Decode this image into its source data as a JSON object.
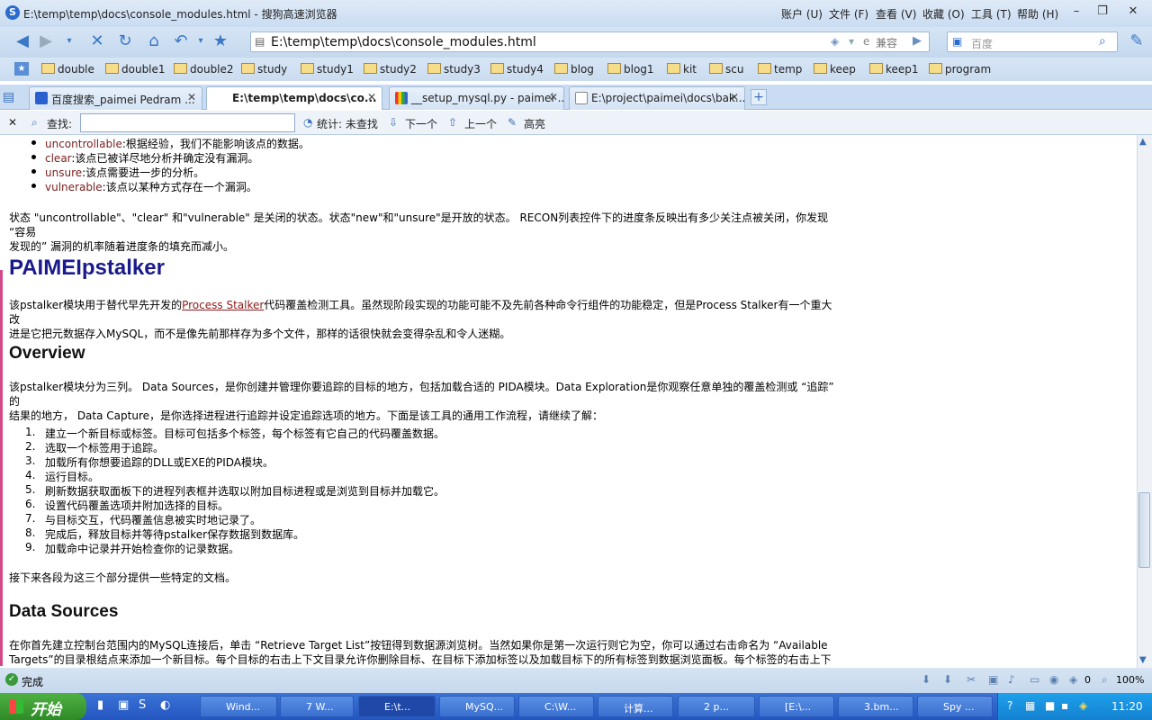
{
  "window": {
    "title": "E:\\temp\\temp\\docs\\console_modules.html - 搜狗高速浏览器",
    "menus": [
      "账户 (U)",
      "文件 (F)",
      "查看 (V)",
      "收藏 (O)",
      "工具 (T)",
      "帮助 (H)"
    ]
  },
  "address": {
    "url": "E:\\temp\\temp\\docs\\console_modules.html",
    "compat": "兼容",
    "search_placeholder": "百度"
  },
  "bookmarks": [
    "double",
    "double1",
    "double2",
    "study",
    "study1",
    "study2",
    "study3",
    "study4",
    "blog",
    "blog1",
    "kit",
    "scu",
    "temp",
    "keep",
    "keep1",
    "program"
  ],
  "tabs": [
    {
      "label": "百度搜索_paimei Pedram ..."
    },
    {
      "label": "E:\\temp\\temp\\docs\\co..."
    },
    {
      "label": "__setup_mysql.py - paimei ..."
    },
    {
      "label": "E:\\project\\paimei\\docs\\bak..."
    }
  ],
  "findbar": {
    "find_label": "查找:",
    "stats": "统计: 未查找",
    "next": "下一个",
    "prev": "上一个",
    "highlight": "高亮"
  },
  "content": {
    "bullets": [
      {
        "k": "uncontrollable",
        "t": ":根据经验，我们不能影响该点的数据。"
      },
      {
        "k": "clear",
        "t": ":该点已被详尽地分析并确定没有漏洞。"
      },
      {
        "k": "unsure",
        "t": ":该点需要进一步的分析。"
      },
      {
        "k": "vulnerable",
        "t": ":该点以某种方式存在一个漏洞。"
      }
    ],
    "state_p1": "状态 \"uncontrollable\"、\"clear\" 和\"vulnerable\" 是关闭的状态。状态\"new\"和\"unsure\"是开放的状态。 RECON列表控件下的进度条反映出有多少关注点被关闭，你发现 “容易",
    "state_p2": "发现的” 漏洞的机率随着进度条的填充而减小。",
    "h_pstalker": "PAIMEIpstalker",
    "pst_p1": "该pstalker模块用于替代早先开发的",
    "pst_link": "Process Stalker",
    "pst_p1b": "代码覆盖检测工具。虽然现阶段实现的功能可能不及先前各种命令行组件的功能稳定，但是Process Stalker有一个重大改",
    "pst_p2": "进是它把元数据存入MySQL，而不是像先前那样存为多个文件，那样的话很快就会变得杂乱和令人迷糊。",
    "h_overview": "Overview",
    "ov_p1": "该pstalker模块分为三列。 Data Sources，是你创建并管理你要追踪的目标的地方，包括加载合适的 PIDA模块。Data Exploration是你观察任意单独的覆盖检测或 “追踪” 的",
    "ov_p2": "结果的地方， Data Capture，是你选择进程进行追踪并设定追踪选项的地方。下面是该工具的通用工作流程，请继续了解：",
    "steps": [
      "建立一个新目标或标签。目标可包括多个标签，每个标签有它自己的代码覆盖数据。",
      "选取一个标签用于追踪。",
      "加载所有你想要追踪的DLL或EXE的PIDA模块。",
      "运行目标。",
      "刷新数据获取面板下的进程列表框并选取以附加目标进程或是浏览到目标并加载它。",
      "设置代码覆盖选项并附加选择的目标。",
      "与目标交互，代码覆盖信息被实时地记录了。",
      "完成后，释放目标并等待pstalker保存数据到数据库。",
      "加载命中记录并开始检查你的记录数据。"
    ],
    "next_p": "接下来各段为这三个部分提供一些特定的文档。",
    "h_ds": "Data Sources",
    "ds_p1": "在你首先建立控制台范围内的MySQL连接后，单击 “Retrieve Target List”按钮得到数据源浏览树。当然如果你是第一次运行则它为空，你可以通过右击命名为 “Available",
    "ds_p2": "Targets”的目录根结点来添加一个新目标。每个目标的右击上下文目录允许你删除目标、在目标下添加标签以及加载目标下的所有标签到数据浏览面板。每个标签的右击上下"
  },
  "status": {
    "text": "完成",
    "zoom": "100%",
    "count": "0"
  },
  "taskbar": {
    "start": "开始",
    "items": [
      "Wind...",
      "7 W...",
      "E:\\t...",
      "MySQ...",
      "C:\\W...",
      "计算...",
      "2 p...",
      "[E:\\...",
      "3.bm...",
      "Spy ..."
    ],
    "clock": "11:20"
  }
}
